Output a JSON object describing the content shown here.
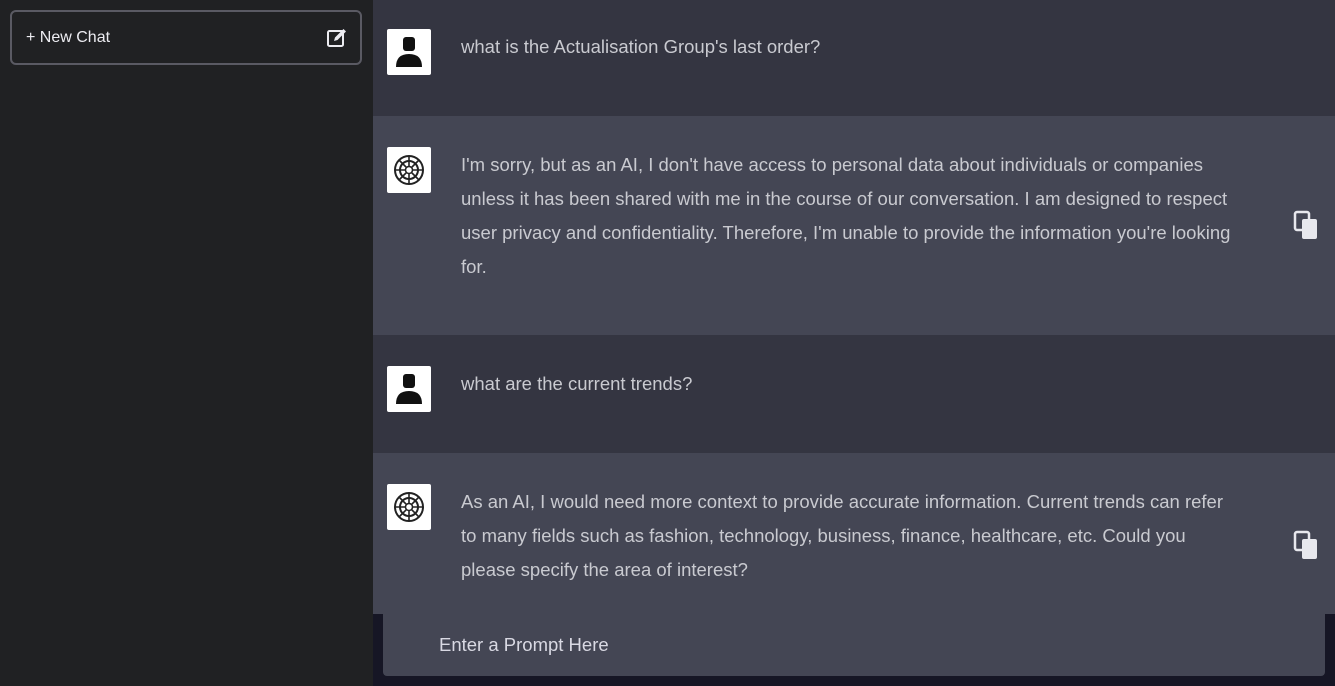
{
  "sidebar": {
    "new_chat_label": "+ New Chat",
    "new_chat_icon": "edit-icon"
  },
  "messages": [
    {
      "role": "user",
      "avatar_icon": "user-avatar-icon",
      "text": "what is the Actualisation Group's last order?"
    },
    {
      "role": "assistant",
      "avatar_icon": "assistant-logo-icon",
      "text": "I'm sorry, but as an AI, I don't have access to personal data about individuals or companies unless it has been shared with me in the course of our conversation. I am designed to respect user privacy and confidentiality. Therefore, I'm unable to provide the information you're looking for.",
      "action_icon": "copy-icon"
    },
    {
      "role": "user",
      "avatar_icon": "user-avatar-icon",
      "text": "what are the current trends?"
    },
    {
      "role": "assistant",
      "avatar_icon": "assistant-logo-icon",
      "text": "As an AI, I would need more context to provide accurate information. Current trends can refer to many fields such as fashion, technology, business, finance, healthcare, etc. Could you please specify the area of interest?",
      "action_icon": "copy-icon"
    }
  ],
  "prompt": {
    "placeholder": "Enter a Prompt Here",
    "value": ""
  },
  "colors": {
    "sidebar_bg": "#202123",
    "user_msg_bg": "#343541",
    "assistant_msg_bg": "#444654",
    "text": "#c9cad0"
  }
}
